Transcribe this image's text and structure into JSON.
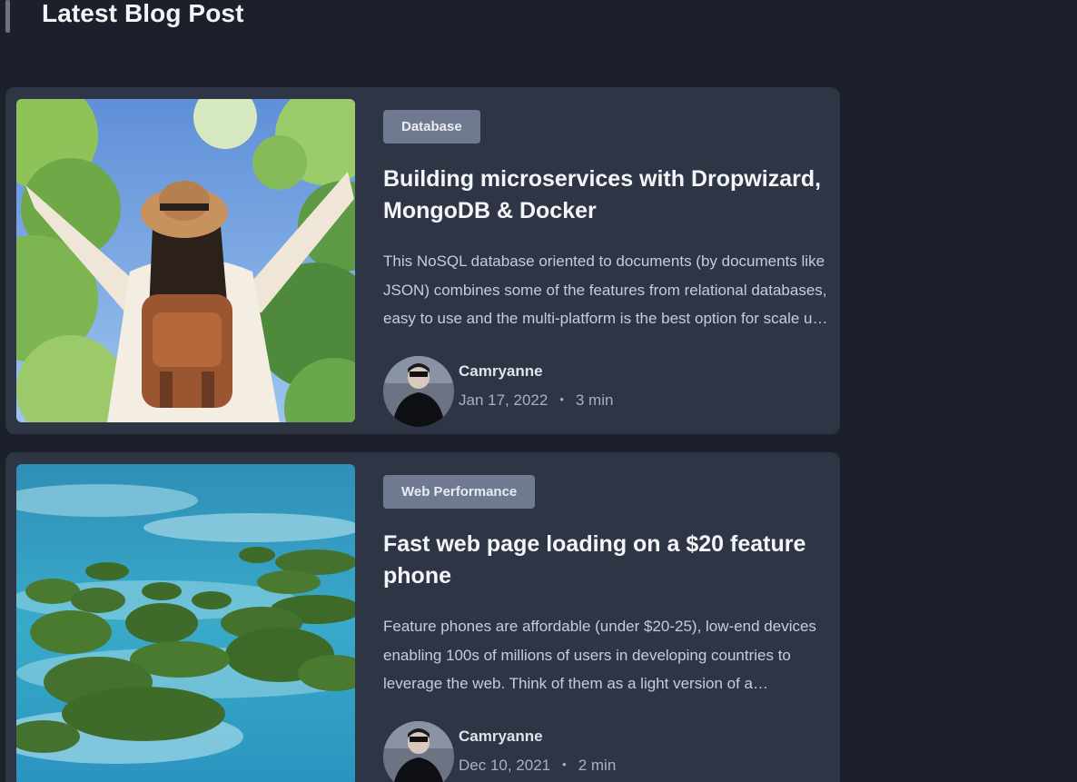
{
  "section": {
    "title": "Latest Blog Post"
  },
  "posts": [
    {
      "tag": "Database",
      "title": "Building microservices with Dropwizard, MongoDB & Docker",
      "excerpt": "This NoSQL database oriented to documents (by documents like JSON) combines some of the features from relational databases, easy to use and the multi-platform is the best option for scale up and have fault tolerance, load balancing, map reduce, etc.",
      "author": "Camryanne",
      "date": "Jan 17, 2022",
      "read_time": "3 min",
      "separator": "•",
      "image": "traveler-with-backpack-photo"
    },
    {
      "tag": "Web Performance",
      "title": "Fast web page loading on a $20 feature phone",
      "excerpt": "Feature phones are affordable (under $20-25), low-end devices enabling 100s of millions of users in developing countries to leverage the web. Think of them as a light version of a smartphone.",
      "author": "Camryanne",
      "date": "Dec 10, 2021",
      "read_time": "2 min",
      "separator": "•",
      "image": "tropical-islands-aerial-photo"
    }
  ],
  "colors": {
    "background": "#1b202b",
    "card": "#2e3645",
    "tag": "#6f7990",
    "accent_bar": "#6c7282"
  }
}
